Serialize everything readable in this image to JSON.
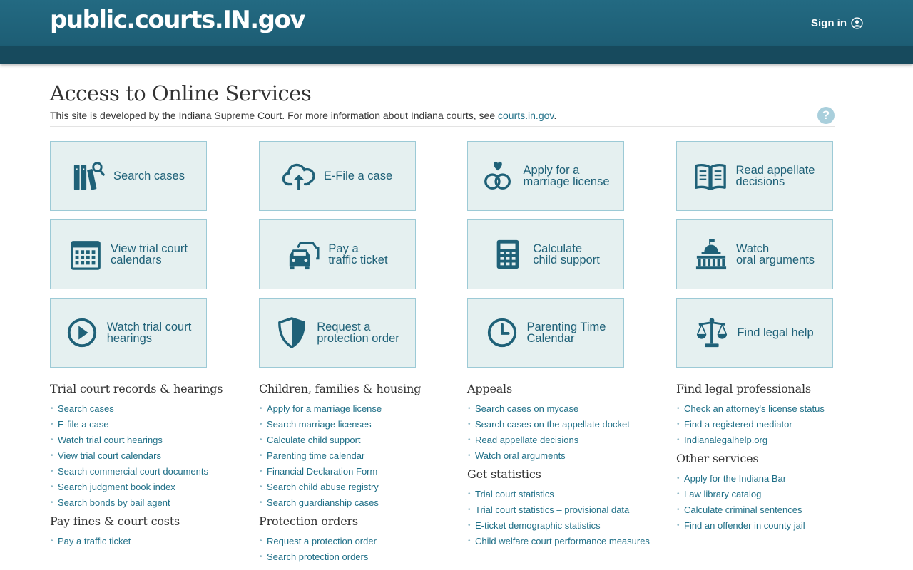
{
  "header": {
    "brand": "public.courts.IN.gov",
    "signin_label": "Sign in"
  },
  "page": {
    "title": "Access to Online Services",
    "intro_text": "This site is developed by the Indiana Supreme Court. For more information about Indiana courts, see ",
    "intro_link": "courts.in.gov",
    "intro_end": ".",
    "help_label": "?"
  },
  "tiles": {
    "search_cases": "Search cases",
    "efile": "E-File a case",
    "marriage": "Apply for a\nmarriage license",
    "appellate": "Read appellate\ndecisions",
    "calendars": "View trial court\ncalendars",
    "ticket": "Pay a\ntraffic ticket",
    "child_support": "Calculate\nchild support",
    "oral_args": "Watch\noral arguments",
    "hearings": "Watch trial court\nhearings",
    "protection": "Request a\nprotection order",
    "parenting": "Parenting Time\nCalendar",
    "legal_help": "Find legal help"
  },
  "col1": {
    "h1": "Trial court records & hearings",
    "links1": [
      "Search cases",
      "E-file a case",
      "Watch trial court hearings",
      "View trial court calendars",
      "Search commercial court documents",
      "Search judgment book index",
      "Search bonds by bail agent"
    ],
    "h2": "Pay fines & court costs",
    "links2": [
      "Pay a traffic ticket"
    ]
  },
  "col2": {
    "h1": "Children, families & housing",
    "links1": [
      "Apply for a marriage license",
      "Search marriage licenses",
      "Calculate child support",
      "Parenting time calendar",
      "Financial Declaration Form",
      "Search child abuse registry",
      "Search guardianship cases"
    ],
    "h2": "Protection orders",
    "links2": [
      "Request a protection order",
      "Search protection orders"
    ]
  },
  "col3": {
    "h1": "Appeals",
    "links1": [
      "Search cases on mycase",
      "Search cases on the appellate docket",
      "Read appellate decisions",
      "Watch oral arguments"
    ],
    "h2": "Get statistics",
    "links2": [
      "Trial court statistics",
      "Trial court statistics – provisional data",
      "E-ticket demographic statistics",
      "Child welfare court performance measures"
    ]
  },
  "col4": {
    "h1": "Find legal professionals",
    "links1": [
      "Check an attorney's license status",
      "Find a registered mediator",
      "Indianalegalhelp.org"
    ],
    "h2": "Other services",
    "links2": [
      "Apply for the Indiana Bar",
      "Law library catalog",
      "Calculate criminal sentences",
      "Find an offender in county jail"
    ]
  },
  "colors": {
    "header": "#1f6178",
    "tile_bg": "#e5f0f0",
    "tile_border": "#9ccad6",
    "link": "#1f6f87",
    "icon": "#1f6178"
  }
}
